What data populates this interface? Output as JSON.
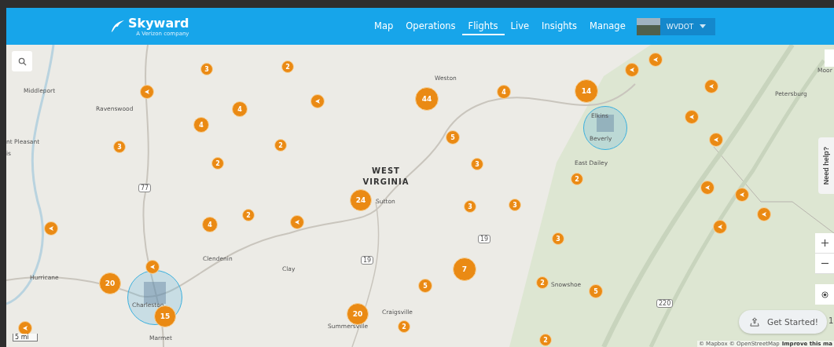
{
  "header": {
    "logo": {
      "name": "Skyward",
      "tagline": "A Verizon company"
    },
    "nav": [
      {
        "label": "Map",
        "selected": false
      },
      {
        "label": "Operations",
        "selected": false
      },
      {
        "label": "Flights",
        "selected": true
      },
      {
        "label": "Live",
        "selected": false
      },
      {
        "label": "Insights",
        "selected": false
      },
      {
        "label": "Manage",
        "selected": false
      }
    ],
    "account": {
      "name": "WVDOT"
    }
  },
  "map": {
    "state_label": "WEST VIRGINIA",
    "places": [
      "Middleport",
      "Ravenswood",
      "nt Pleasant",
      "is",
      "Weston",
      "Petersburg",
      "Moor",
      "Elkins",
      "Beverly",
      "East Dailey",
      "Sutton",
      "Clendenin",
      "Clay",
      "Hurricane",
      "Charleston",
      "Marmet",
      "Summersville",
      "Craigsville",
      "Snowshoe"
    ],
    "road_shields": [
      "77",
      "19",
      "19",
      "220"
    ],
    "markers": [
      {
        "kind": "cluster",
        "count": "3"
      },
      {
        "kind": "cluster",
        "count": "2"
      },
      {
        "kind": "cluster",
        "count": "4"
      },
      {
        "kind": "cluster",
        "count": "4"
      },
      {
        "kind": "cluster",
        "count": "3"
      },
      {
        "kind": "cluster",
        "count": "2"
      },
      {
        "kind": "cluster",
        "count": "2"
      },
      {
        "kind": "cluster",
        "count": "44"
      },
      {
        "kind": "cluster",
        "count": "4"
      },
      {
        "kind": "cluster",
        "count": "14"
      },
      {
        "kind": "cluster",
        "count": "5"
      },
      {
        "kind": "cluster",
        "count": "3"
      },
      {
        "kind": "cluster",
        "count": "2"
      },
      {
        "kind": "cluster",
        "count": "24"
      },
      {
        "kind": "cluster",
        "count": "2"
      },
      {
        "kind": "cluster",
        "count": "4"
      },
      {
        "kind": "cluster",
        "count": "3"
      },
      {
        "kind": "cluster",
        "count": "3"
      },
      {
        "kind": "cluster",
        "count": "3"
      },
      {
        "kind": "cluster",
        "count": "7"
      },
      {
        "kind": "cluster",
        "count": "5"
      },
      {
        "kind": "cluster",
        "count": "2"
      },
      {
        "kind": "cluster",
        "count": "5"
      },
      {
        "kind": "cluster",
        "count": "20"
      },
      {
        "kind": "cluster",
        "count": "15"
      },
      {
        "kind": "cluster",
        "count": "20"
      },
      {
        "kind": "cluster",
        "count": "2"
      },
      {
        "kind": "cluster",
        "count": "2"
      },
      {
        "kind": "drone"
      },
      {
        "kind": "drone"
      },
      {
        "kind": "drone"
      },
      {
        "kind": "drone"
      },
      {
        "kind": "drone"
      },
      {
        "kind": "drone"
      },
      {
        "kind": "drone"
      },
      {
        "kind": "drone"
      },
      {
        "kind": "drone"
      },
      {
        "kind": "drone"
      },
      {
        "kind": "drone"
      },
      {
        "kind": "drone"
      },
      {
        "kind": "drone"
      },
      {
        "kind": "drone"
      },
      {
        "kind": "drone"
      }
    ],
    "scale": "5 mi",
    "attribution": {
      "text": "© Mapbox © OpenStreetMap",
      "link": "Improve this ma"
    }
  },
  "help_tab": "Need help?",
  "get_started": {
    "label": "Get Started!",
    "badge": "1"
  }
}
